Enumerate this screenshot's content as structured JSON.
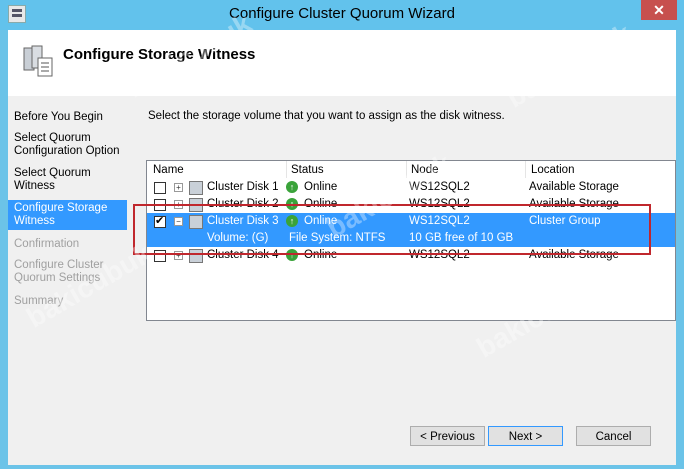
{
  "window": {
    "title": "Configure Cluster Quorum Wizard",
    "close_label": "✕"
  },
  "header": {
    "title": "Configure Storage Witness"
  },
  "nav": [
    {
      "label_lines": [
        "Before You Begin"
      ]
    },
    {
      "label_lines": [
        "Select Quorum",
        "Configuration Option"
      ]
    },
    {
      "label_lines": [
        "Select Quorum",
        "Witness"
      ]
    },
    {
      "label_lines": [
        "Configure Storage",
        "Witness"
      ]
    },
    {
      "label_lines": [
        "Confirmation"
      ]
    },
    {
      "label_lines": [
        "Configure Cluster",
        "Quorum Settings"
      ]
    },
    {
      "label_lines": [
        "Summary"
      ]
    }
  ],
  "content": {
    "instruction": "Select the storage volume that you want to assign as the disk witness.",
    "columns": [
      "Name",
      "Status",
      "Node",
      "Location"
    ],
    "rows": [
      {
        "name": "Cluster Disk 1",
        "status": "Online",
        "node": "WS12SQL2",
        "location": "Available Storage",
        "checked": false,
        "expander": "+"
      },
      {
        "name": "Cluster Disk 2",
        "status": "Online",
        "node": "WS12SQL2",
        "location": "Available Storage",
        "checked": false,
        "expander": "+"
      },
      {
        "name": "Cluster Disk 3",
        "status": "Online",
        "node": "WS12SQL2",
        "location": "Cluster Group",
        "checked": true,
        "expander": "−"
      },
      {
        "name": "Cluster Disk 4",
        "status": "Online",
        "node": "WS12SQL2",
        "location": "Available Storage",
        "checked": false,
        "expander": "+"
      }
    ],
    "volume_row": {
      "volume": "Volume: (G)",
      "filesystem": "File System: NTFS",
      "free": "10 GB free of 10 GB"
    }
  },
  "buttons": {
    "previous": "< Previous",
    "next": "Next >",
    "cancel": "Cancel"
  },
  "watermark": "bakicubuk",
  "colors": {
    "titlebar": "#62c2ec",
    "selection": "#3399ff",
    "highlight_box": "#c0272d"
  }
}
